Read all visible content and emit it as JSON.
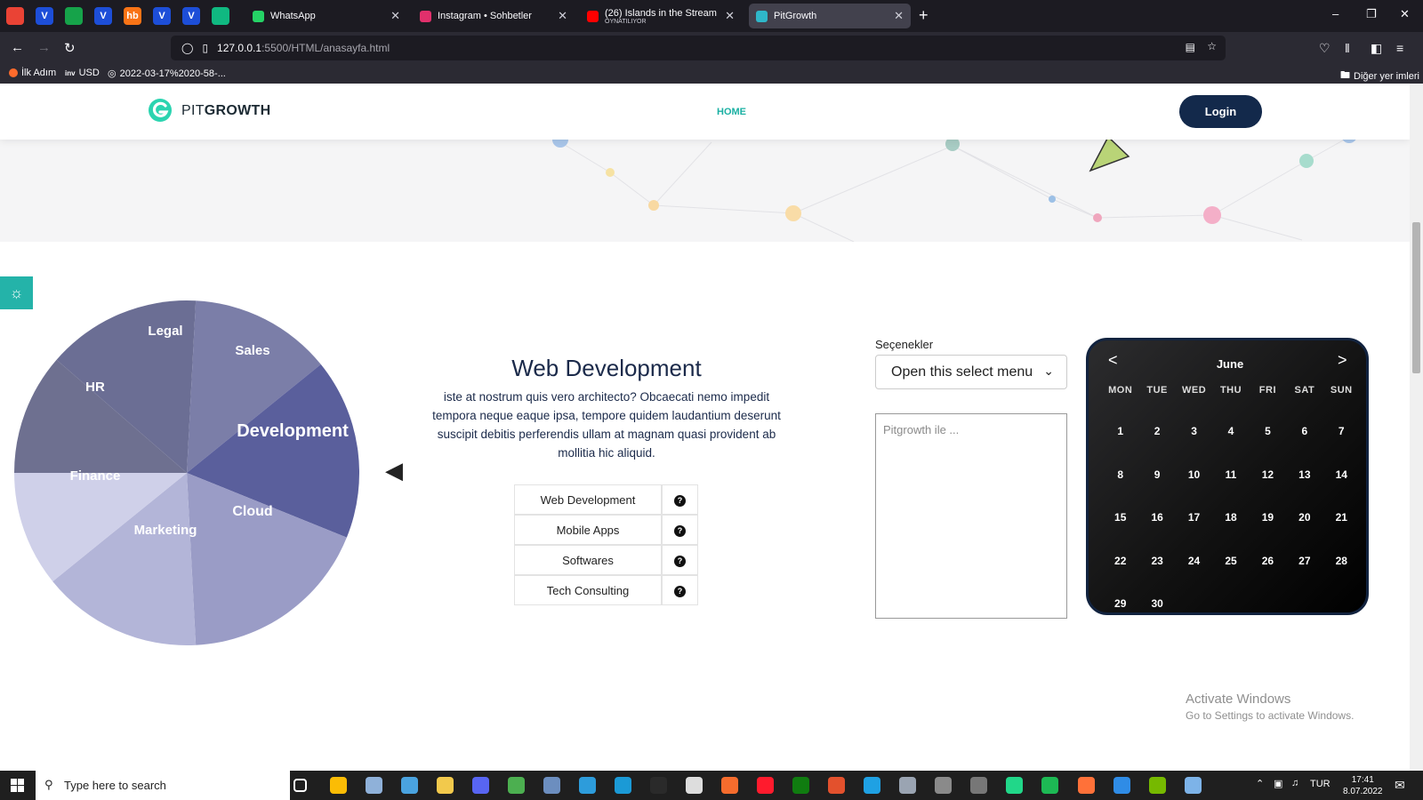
{
  "browser": {
    "pinned_tabs": [
      {
        "icon": "gmail-icon",
        "letter": "",
        "color": "#ea4335"
      },
      {
        "icon": "v-app-icon",
        "letter": "V",
        "color": "#1d4ed8"
      },
      {
        "icon": "leaf-icon",
        "letter": "",
        "color": "#16a34a"
      },
      {
        "icon": "v-app-icon",
        "letter": "V",
        "color": "#1d4ed8"
      },
      {
        "icon": "hb-icon",
        "letter": "hb",
        "color": "#f97316"
      },
      {
        "icon": "v-app-icon",
        "letter": "V",
        "color": "#1d4ed8"
      },
      {
        "icon": "v-app-icon",
        "letter": "V",
        "color": "#1d4ed8"
      },
      {
        "icon": "ai-icon",
        "letter": "",
        "color": "#10b981"
      }
    ],
    "tabs": [
      {
        "title": "WhatsApp",
        "subtitle": "",
        "icon": "whatsapp-icon",
        "color": "#25d366",
        "active": false
      },
      {
        "title": "Instagram • Sohbetler",
        "subtitle": "",
        "icon": "instagram-icon",
        "color": "#e1306c",
        "active": false
      },
      {
        "title": "(26) Islands in the Stream cover",
        "subtitle": "OYNATILIYOR",
        "icon": "youtube-icon",
        "color": "#ff0000",
        "active": false
      },
      {
        "title": "PitGrowth",
        "subtitle": "",
        "icon": "diamond-icon",
        "color": "#2fb7c9",
        "active": true
      }
    ],
    "url_host": "127.0.0.1",
    "url_path": ":5500/HTML/anasayfa.html",
    "bookmarks": [
      {
        "label": "İlk Adım",
        "icon": "firefox-icon"
      },
      {
        "label": "USD",
        "icon": "inv-icon"
      },
      {
        "label": "2022-03-17%2020-58-...",
        "icon": "globe-icon"
      }
    ],
    "other_bookmarks": "Diğer yer imleri"
  },
  "site": {
    "logo_text_light": "PIT",
    "logo_text_bold": "GROWTH",
    "nav_home": "HOME",
    "login": "Login",
    "brand_color": "#13294b",
    "accent_color": "#1ab0a3"
  },
  "pie": {
    "segments": [
      {
        "label": "Legal",
        "color": "#6b6e94"
      },
      {
        "label": "Sales",
        "color": "#7b7ea8"
      },
      {
        "label": "Development",
        "color": "#5a5f9c"
      },
      {
        "label": "Cloud",
        "color": "#9a9cc6"
      },
      {
        "label": "Marketing",
        "color": "#b3b5d8"
      },
      {
        "label": "Finance",
        "color": "#cfd0e9"
      },
      {
        "label": "HR",
        "color": "#6e7090"
      }
    ]
  },
  "web_dev": {
    "title": "Web Development",
    "text": "iste at nostrum quis vero architecto? Obcaecati nemo impedit tempora neque eaque ipsa, tempore quidem laudantium deserunt suscipit debitis perferendis ullam at magnam quasi provident ab mollitia hic aliquid.",
    "services": [
      "Web Development",
      "Mobile Apps",
      "Softwares",
      "Tech Consulting"
    ]
  },
  "form": {
    "select_label": "Seçenekler",
    "select_value": "Open this select menu",
    "textarea_placeholder": "Pitgrowth ile ..."
  },
  "calendar": {
    "month": "June",
    "prev": "<",
    "next": ">",
    "weekdays": [
      "MON",
      "TUE",
      "WED",
      "THU",
      "FRI",
      "SAT",
      "SUN"
    ],
    "days": [
      "1",
      "2",
      "3",
      "4",
      "5",
      "6",
      "7",
      "8",
      "9",
      "10",
      "11",
      "12",
      "13",
      "14",
      "15",
      "16",
      "17",
      "18",
      "19",
      "20",
      "21",
      "22",
      "23",
      "24",
      "25",
      "26",
      "27",
      "28",
      "29",
      "30"
    ]
  },
  "windows": {
    "activate_title": "Activate Windows",
    "activate_sub": "Go to Settings to activate Windows.",
    "search_placeholder": "Type here to search",
    "language": "TUR",
    "time": "17:41",
    "date": "8.07.2022"
  }
}
